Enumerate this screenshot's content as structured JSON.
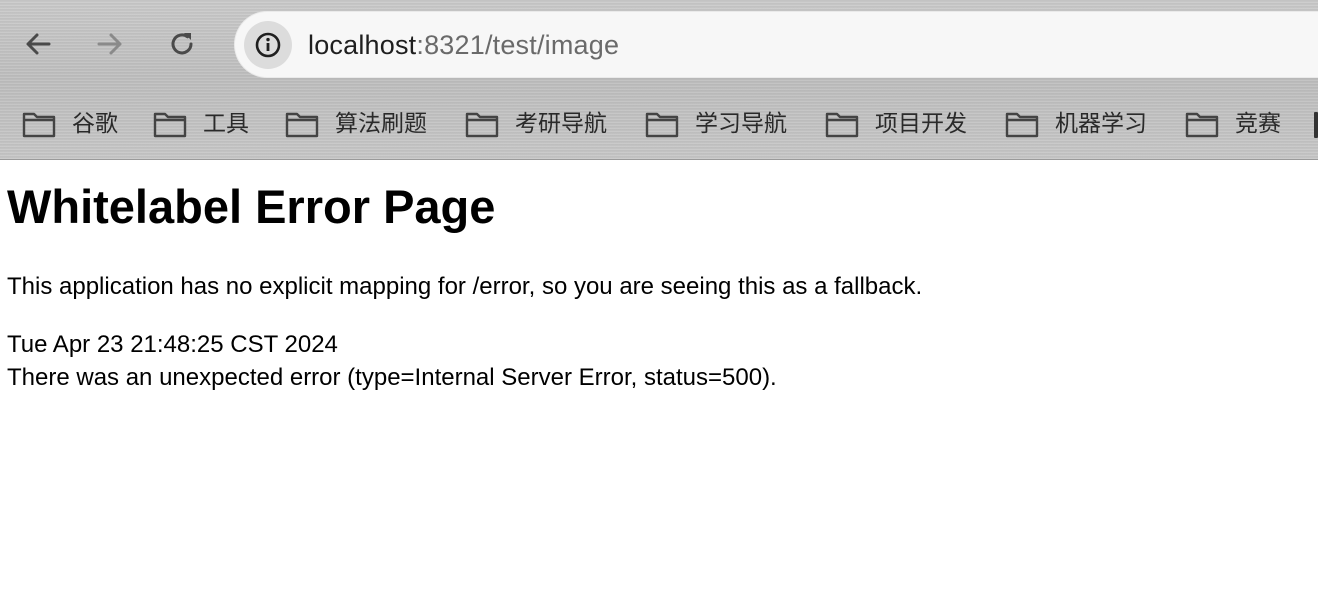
{
  "browser": {
    "address_bar": {
      "host": "localhost",
      "rest": ":8321/test/image"
    },
    "icons": {
      "back": "arrow-left-icon",
      "forward": "arrow-right-icon",
      "reload": "reload-icon",
      "site_info": "info-icon",
      "bookmark_folder": "folder-icon"
    },
    "bookmarks": [
      {
        "label": "谷歌"
      },
      {
        "label": "工具"
      },
      {
        "label": "算法刷题"
      },
      {
        "label": "考研导航"
      },
      {
        "label": "学习导航"
      },
      {
        "label": "项目开发"
      },
      {
        "label": "机器学习"
      },
      {
        "label": "竞赛"
      }
    ]
  },
  "page": {
    "title": "Whitelabel Error Page",
    "message": "This application has no explicit mapping for /error, so you are seeing this as a fallback.",
    "timestamp": "Tue Apr 23 21:48:25 CST 2024",
    "error": "There was an unexpected error (type=Internal Server Error, status=500)."
  }
}
